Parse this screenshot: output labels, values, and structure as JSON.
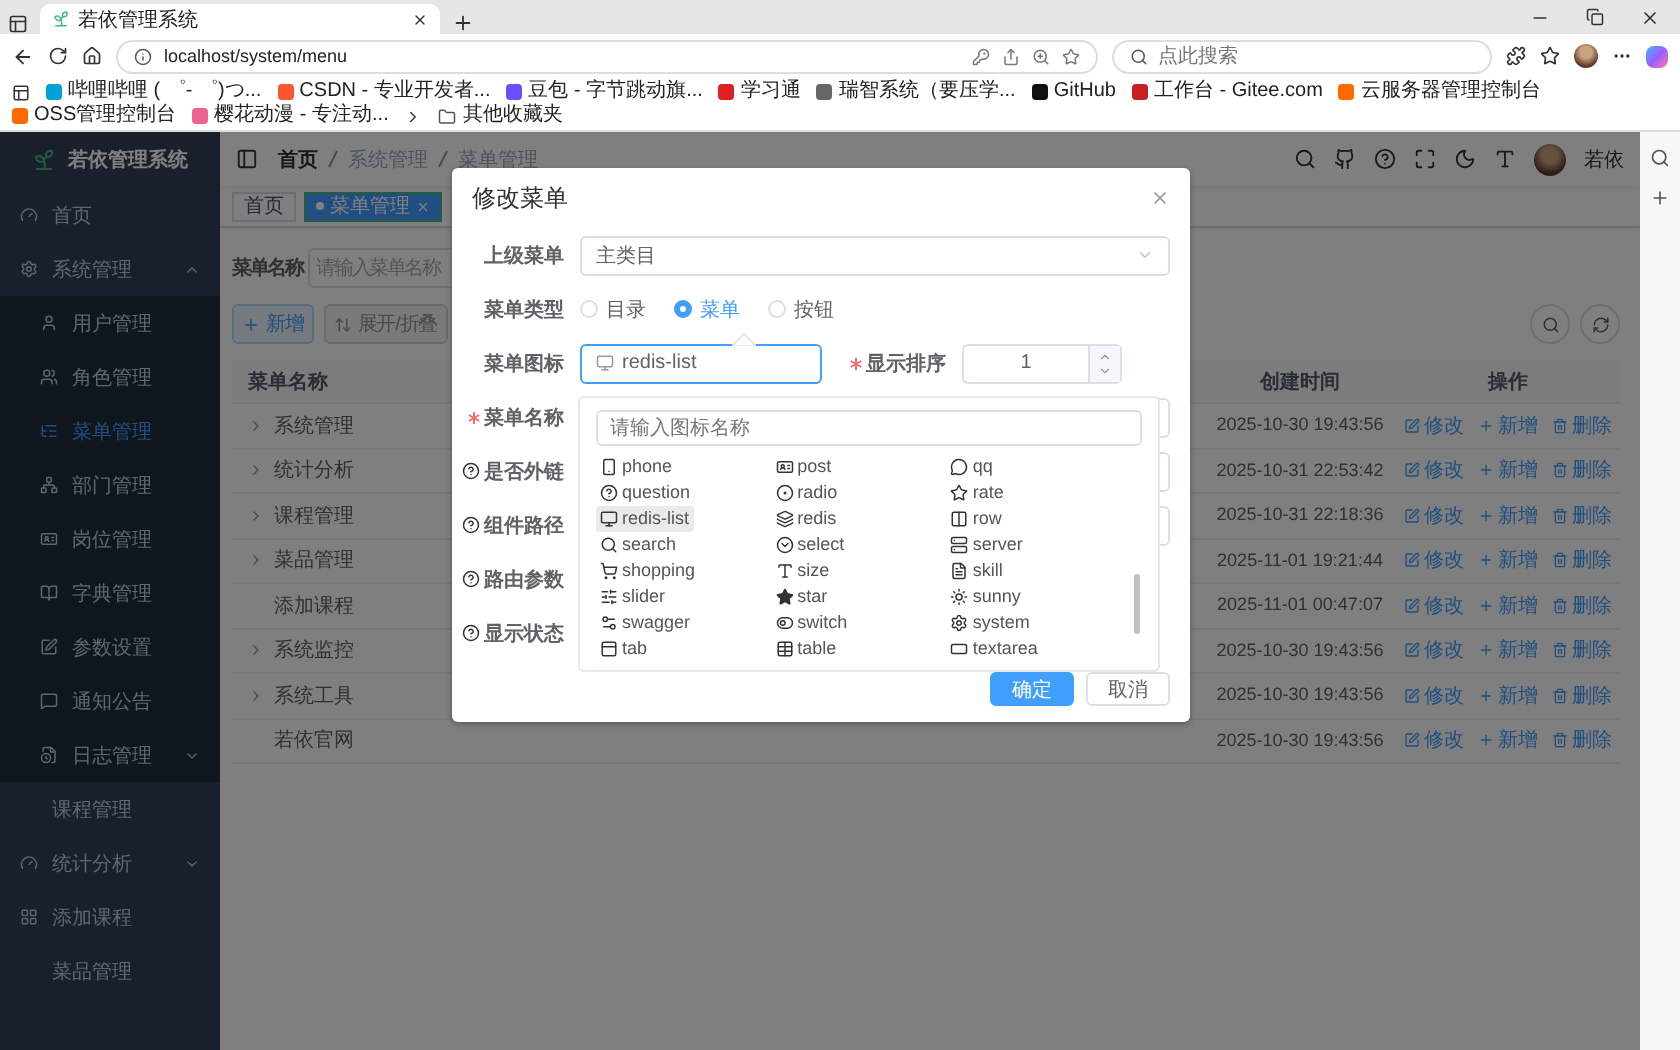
{
  "browser": {
    "tab_title": "若依管理系统",
    "url": "localhost/system/menu",
    "search_placeholder": "点此搜索",
    "bookmarks": [
      "哔哩哔哩 ( ゜- ゜)つ...",
      "CSDN - 专业开发者...",
      "豆包 - 字节跳动旗...",
      "学习通",
      "瑞智系统（要压学...",
      "GitHub",
      "工作台 - Gitee.com",
      "云服务器管理控制台",
      "OSS管理控制台",
      "樱花动漫 - 专注动...",
      "其他收藏夹"
    ]
  },
  "sidebar": {
    "title": "若依管理系统",
    "items": [
      {
        "label": "首页",
        "selected": false
      },
      {
        "label": "系统管理",
        "selected": false,
        "expanded": true,
        "children": [
          {
            "label": "用户管理",
            "selected": false
          },
          {
            "label": "角色管理",
            "selected": false
          },
          {
            "label": "菜单管理",
            "selected": true
          },
          {
            "label": "部门管理",
            "selected": false
          },
          {
            "label": "岗位管理",
            "selected": false
          },
          {
            "label": "字典管理",
            "selected": false
          },
          {
            "label": "参数设置",
            "selected": false
          },
          {
            "label": "通知公告",
            "selected": false
          },
          {
            "label": "日志管理",
            "selected": false,
            "expanded": false
          }
        ]
      },
      {
        "label": "课程管理",
        "selected": false
      },
      {
        "label": "统计分析",
        "selected": false,
        "expanded": false
      },
      {
        "label": "添加课程",
        "selected": false
      },
      {
        "label": "菜品管理",
        "selected": false
      }
    ]
  },
  "navbar": {
    "breadcrumb": [
      "首页",
      "系统管理",
      "菜单管理"
    ],
    "user": "若依"
  },
  "tags": [
    {
      "label": "首页",
      "selected": false
    },
    {
      "label": "菜单管理",
      "selected": true
    }
  ],
  "search": {
    "label": "菜单名称",
    "placeholder": "请输入菜单名称"
  },
  "toolbar": [
    {
      "label": "新增",
      "kind": "add"
    },
    {
      "label": "展开/折叠",
      "kind": "sort"
    }
  ],
  "table": {
    "columns": [
      "菜单名称",
      "创建时间",
      "操作"
    ],
    "rows": [
      {
        "name": "系统管理",
        "expandable": true,
        "created": "2025-10-30 19:43:56",
        "actions": [
          "修改",
          "新增",
          "删除"
        ]
      },
      {
        "name": "统计分析",
        "expandable": true,
        "created": "2025-10-31 22:53:42",
        "actions": [
          "修改",
          "新增",
          "删除"
        ]
      },
      {
        "name": "课程管理",
        "expandable": true,
        "created": "2025-10-31 22:18:36",
        "actions": [
          "修改",
          "新增",
          "删除"
        ]
      },
      {
        "name": "菜品管理",
        "expandable": true,
        "created": "2025-11-01 19:21:44",
        "actions": [
          "修改",
          "新增",
          "删除"
        ]
      },
      {
        "name": "添加课程",
        "expandable": false,
        "created": "2025-11-01 00:47:07",
        "actions": [
          "修改",
          "新增",
          "删除"
        ]
      },
      {
        "name": "系统监控",
        "expandable": true,
        "created": "2025-10-30 19:43:56",
        "actions": [
          "修改",
          "新增",
          "删除"
        ]
      },
      {
        "name": "系统工具",
        "expandable": true,
        "created": "2025-10-30 19:43:56",
        "actions": [
          "修改",
          "新增",
          "删除"
        ]
      },
      {
        "name": "若依官网",
        "expandable": false,
        "created": "2025-10-30 19:43:56",
        "actions": [
          "修改",
          "新增",
          "删除"
        ]
      }
    ]
  },
  "dialog": {
    "title": "修改菜单",
    "fields": [
      {
        "kind": "select",
        "label": "上级菜单",
        "value": "主类目",
        "required": false,
        "help": false
      },
      {
        "kind": "radio",
        "label": "菜单类型",
        "required": false,
        "help": false,
        "options": [
          {
            "label": "目录",
            "selected": false
          },
          {
            "label": "菜单",
            "selected": true
          },
          {
            "label": "按钮",
            "selected": false
          }
        ]
      },
      {
        "kind": "icon",
        "label": "菜单图标",
        "value": "redis-list",
        "required": false,
        "help": false,
        "extra": {
          "label": "显示排序",
          "required": true,
          "value": "1"
        }
      },
      {
        "kind": "input",
        "label": "菜单名称",
        "required": true,
        "help": false
      },
      {
        "kind": "input",
        "label": "是否外链",
        "required": false,
        "help": true
      },
      {
        "kind": "input",
        "label": "组件路径",
        "required": false,
        "help": true
      },
      {
        "kind": "blank",
        "label": "路由参数",
        "required": false,
        "help": true
      },
      {
        "kind": "blank",
        "label": "显示状态",
        "required": false,
        "help": true
      }
    ],
    "buttons": [
      {
        "label": "确定",
        "kind": "primary"
      },
      {
        "label": "取消",
        "kind": "default"
      }
    ]
  },
  "icon_picker": {
    "placeholder": "请输入图标名称",
    "icons": [
      {
        "name": "phone",
        "selected": false
      },
      {
        "name": "post",
        "selected": false
      },
      {
        "name": "qq",
        "selected": false
      },
      {
        "name": "question",
        "selected": false
      },
      {
        "name": "radio",
        "selected": false
      },
      {
        "name": "rate",
        "selected": false
      },
      {
        "name": "redis-list",
        "selected": true
      },
      {
        "name": "redis",
        "selected": false
      },
      {
        "name": "row",
        "selected": false
      },
      {
        "name": "search",
        "selected": false
      },
      {
        "name": "select",
        "selected": false
      },
      {
        "name": "server",
        "selected": false
      },
      {
        "name": "shopping",
        "selected": false
      },
      {
        "name": "size",
        "selected": false
      },
      {
        "name": "skill",
        "selected": false
      },
      {
        "name": "slider",
        "selected": false
      },
      {
        "name": "star",
        "selected": false
      },
      {
        "name": "sunny",
        "selected": false
      },
      {
        "name": "swagger",
        "selected": false
      },
      {
        "name": "switch",
        "selected": false
      },
      {
        "name": "system",
        "selected": false
      },
      {
        "name": "tab",
        "selected": false
      },
      {
        "name": "table",
        "selected": false
      },
      {
        "name": "textarea",
        "selected": false
      }
    ]
  }
}
